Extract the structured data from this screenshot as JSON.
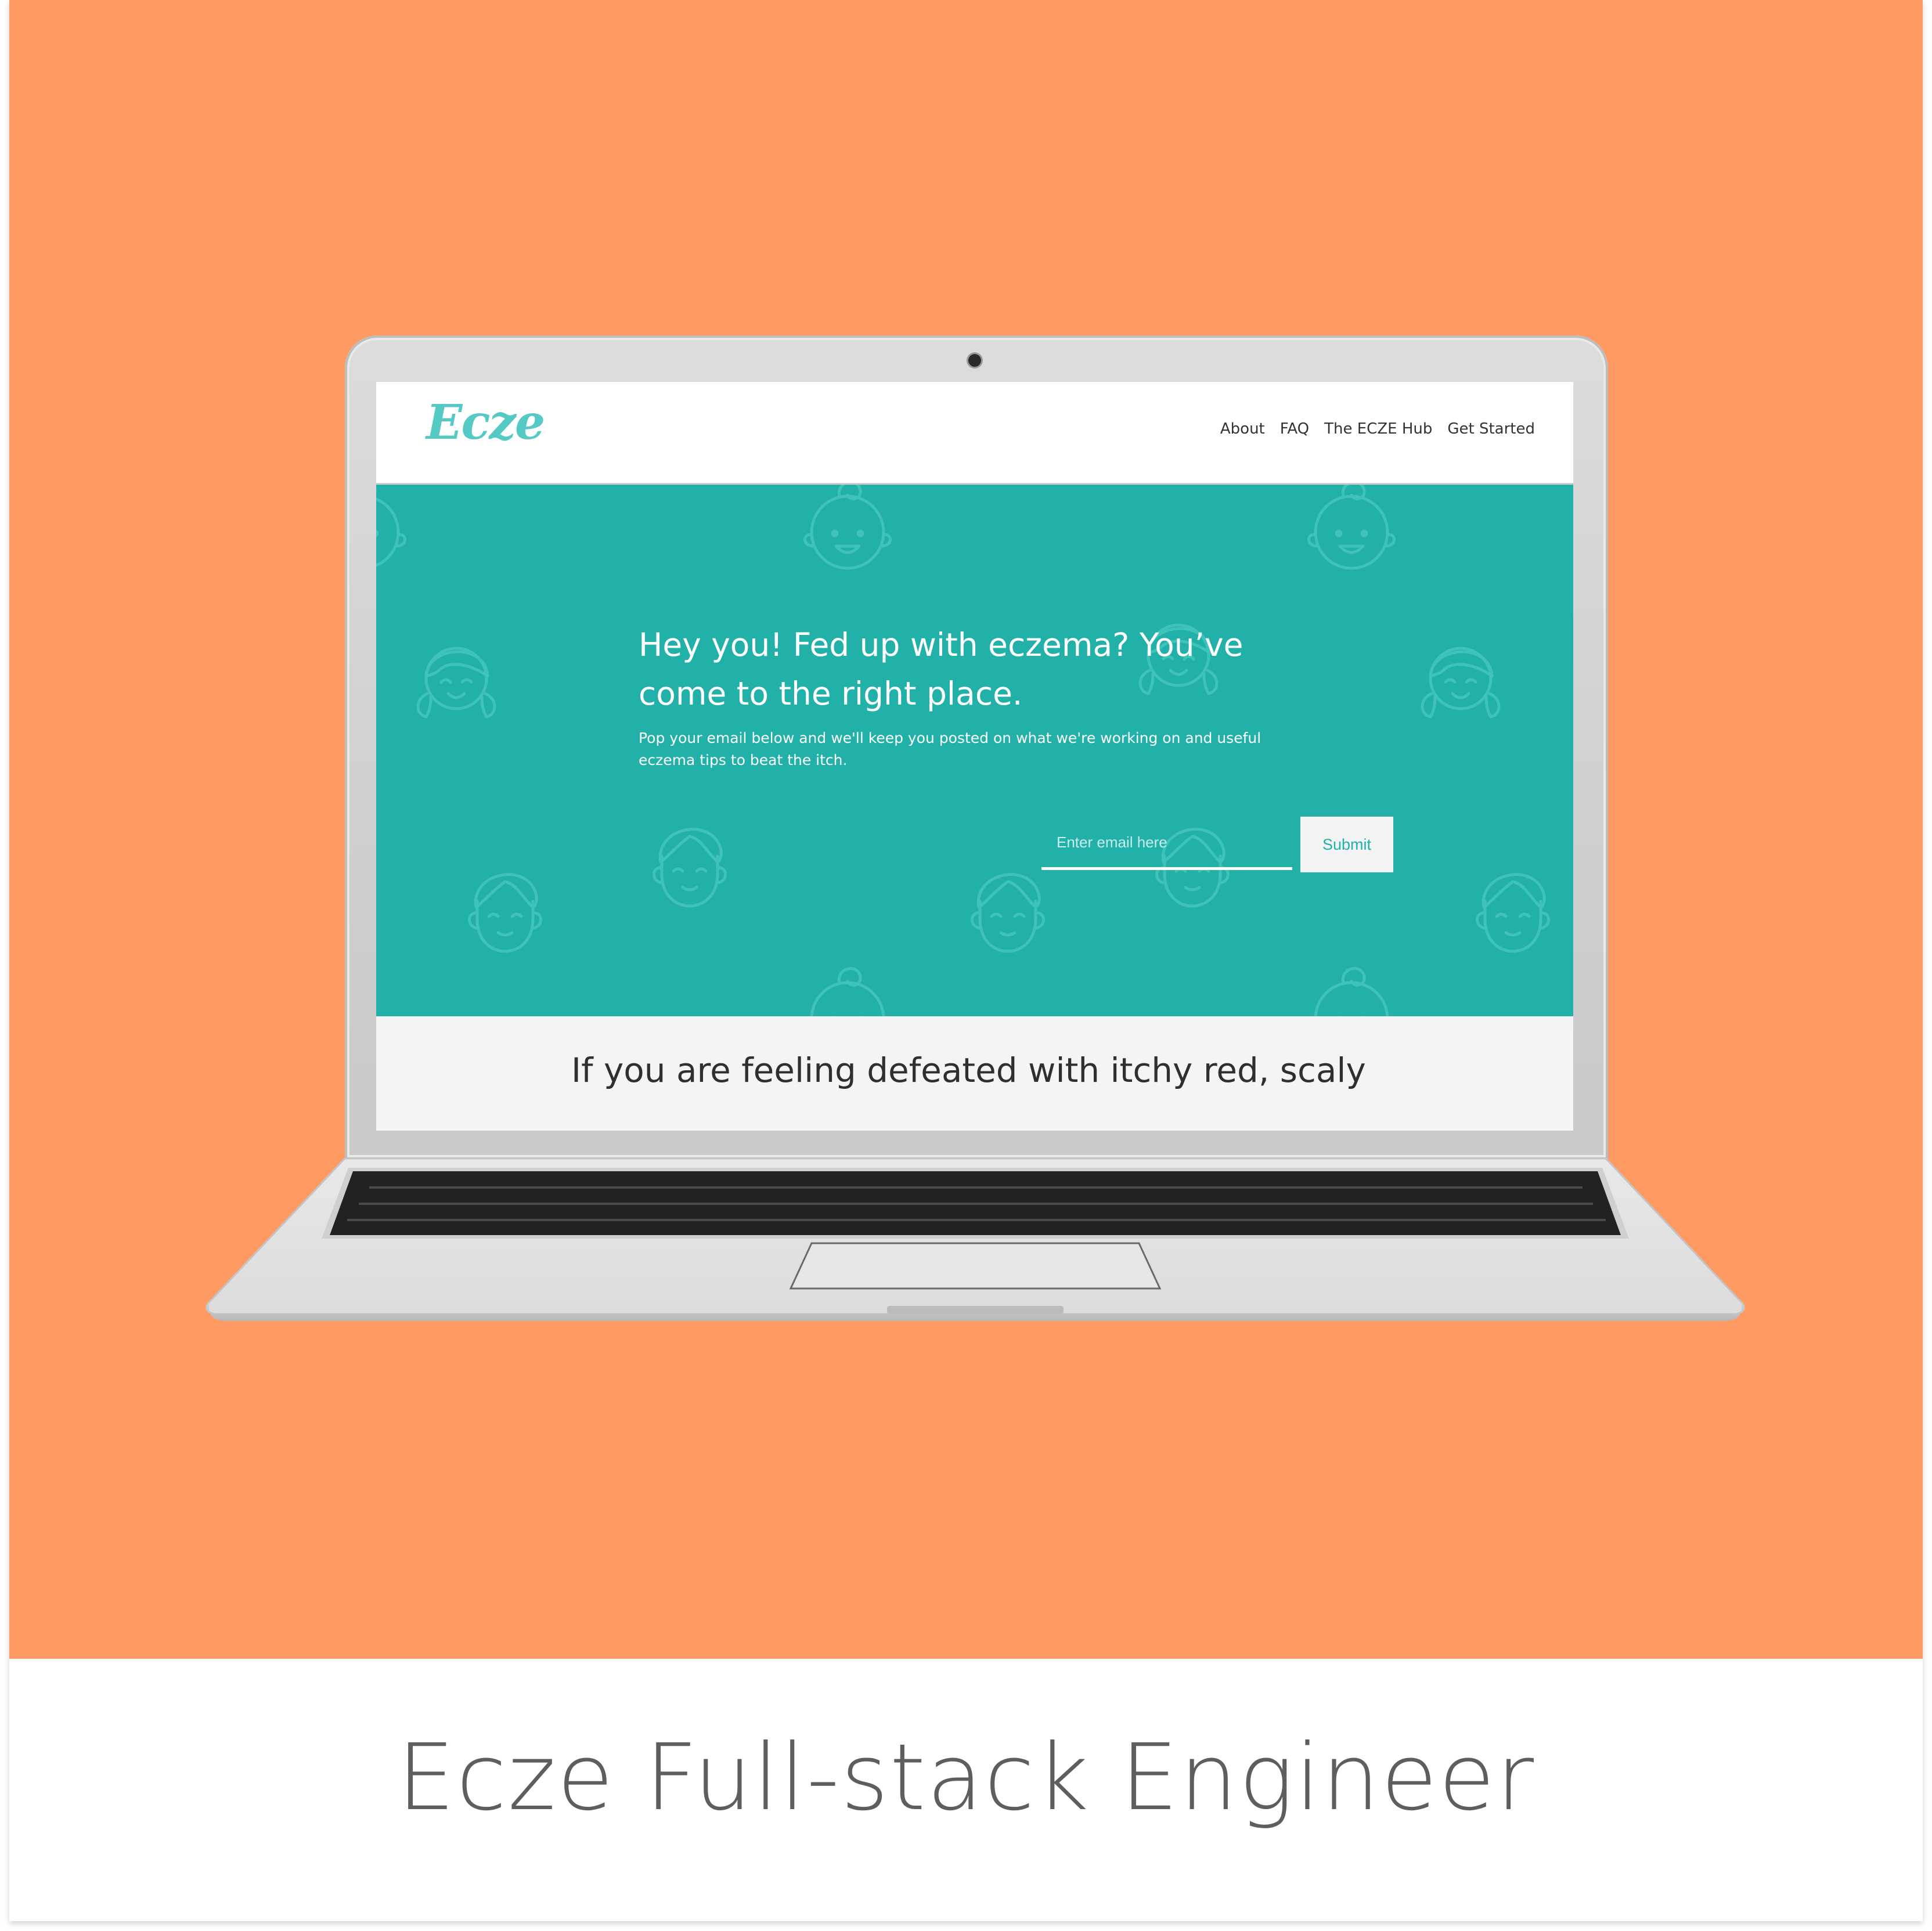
{
  "site": {
    "logo_text": "Ecze",
    "nav": [
      "About",
      "FAQ",
      "The ECZE Hub",
      "Get Started"
    ],
    "hero_title_line1": "Hey you! Fed up with eczema? You’ve",
    "hero_title_line2": "come to the right place.",
    "hero_subtitle": "Pop your email below and we'll keep you posted on what we're working on and useful eczema tips to beat the itch.",
    "email_placeholder": "Enter email here",
    "submit_label": "Submit",
    "section_title": "If you are feeling defeated with itchy red, scaly"
  },
  "caption": "Ecze Full-stack Engineer",
  "colors": {
    "background": "#ff9a62",
    "teal": "#22b1a9",
    "logo": "#55c9c4"
  },
  "icons": [
    "baby-face-icon",
    "girl-face-icon",
    "boy-face-icon"
  ]
}
